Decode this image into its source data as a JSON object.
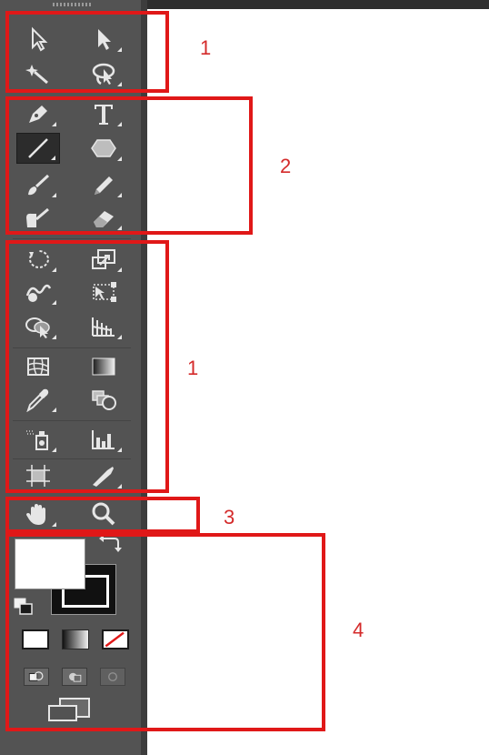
{
  "annotations": {
    "group1_top": "1",
    "group2": "2",
    "group1_mid": "1",
    "group3": "3",
    "group4": "4"
  },
  "colors": {
    "panel": "#535353",
    "annotation_red": "#e01818",
    "icon": "#e6e6e6",
    "background": "#ffffff"
  },
  "tools": [
    {
      "name": "selection-tool",
      "icon": "arrow-outline-icon"
    },
    {
      "name": "direct-selection-tool",
      "icon": "arrow-solid-icon"
    },
    {
      "name": "magic-wand-tool",
      "icon": "magic-wand-icon"
    },
    {
      "name": "lasso-tool",
      "icon": "lasso-icon"
    },
    {
      "name": "pen-tool",
      "icon": "pen-icon"
    },
    {
      "name": "type-tool",
      "icon": "type-icon"
    },
    {
      "name": "line-segment-tool",
      "icon": "line-icon",
      "selected": true
    },
    {
      "name": "polygon-tool",
      "icon": "polygon-icon"
    },
    {
      "name": "paintbrush-tool",
      "icon": "brush-icon"
    },
    {
      "name": "pencil-tool",
      "icon": "pencil-icon"
    },
    {
      "name": "blob-brush-tool",
      "icon": "blob-brush-icon"
    },
    {
      "name": "eraser-tool",
      "icon": "eraser-icon"
    },
    {
      "name": "rotate-tool",
      "icon": "rotate-icon"
    },
    {
      "name": "scale-tool",
      "icon": "scale-icon"
    },
    {
      "name": "warp-tool",
      "icon": "warp-icon"
    },
    {
      "name": "free-transform-tool",
      "icon": "free-transform-icon"
    },
    {
      "name": "shape-builder-tool",
      "icon": "shape-builder-icon"
    },
    {
      "name": "perspective-grid-tool",
      "icon": "perspective-grid-icon"
    },
    {
      "name": "mesh-tool",
      "icon": "mesh-icon"
    },
    {
      "name": "gradient-tool",
      "icon": "gradient-icon"
    },
    {
      "name": "eyedropper-tool",
      "icon": "eyedropper-icon"
    },
    {
      "name": "blend-tool",
      "icon": "blend-icon"
    },
    {
      "name": "symbol-sprayer-tool",
      "icon": "symbol-sprayer-icon"
    },
    {
      "name": "column-graph-tool",
      "icon": "column-graph-icon"
    },
    {
      "name": "artboard-tool",
      "icon": "artboard-icon"
    },
    {
      "name": "slice-tool",
      "icon": "slice-icon"
    },
    {
      "name": "hand-tool",
      "icon": "hand-icon"
    },
    {
      "name": "zoom-tool",
      "icon": "zoom-icon"
    }
  ]
}
